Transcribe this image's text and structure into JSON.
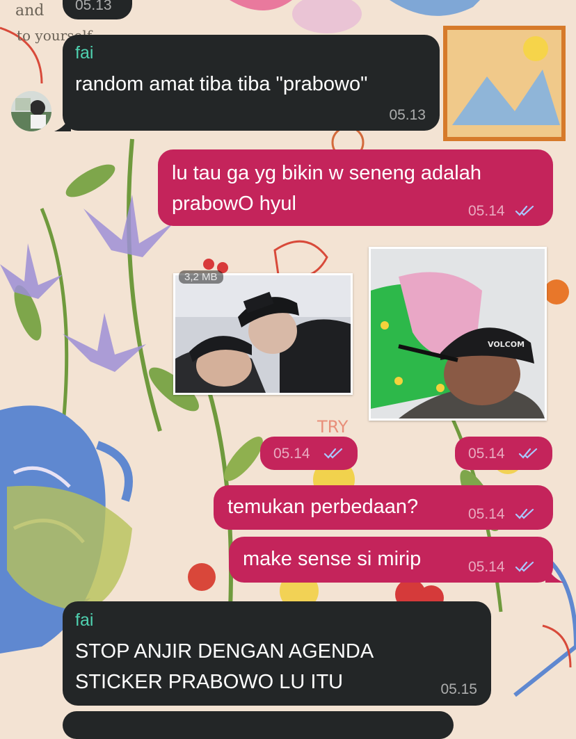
{
  "chat": {
    "top_partial_time": "05.13",
    "messages": [
      {
        "id": "m1",
        "direction": "incoming",
        "sender": "fai",
        "text": "random amat tiba tiba \"prabowo\"",
        "time": "05.13"
      },
      {
        "id": "m2",
        "direction": "outgoing",
        "text": "lu tau ga yg bikin w seneng adalah\nprabowO hyul",
        "time": "05.14",
        "status": "read"
      },
      {
        "id": "m3",
        "direction": "outgoing",
        "type": "image",
        "file_size": "3,2 MB",
        "time": "05.14",
        "status": "read"
      },
      {
        "id": "m4",
        "direction": "outgoing",
        "type": "image",
        "cap_text": "VOLCOM",
        "time": "05.14",
        "status": "read"
      },
      {
        "id": "m5",
        "direction": "outgoing",
        "text": "temukan perbedaan?",
        "time": "05.14",
        "status": "read"
      },
      {
        "id": "m6",
        "direction": "outgoing",
        "text": "make sense si mirip",
        "time": "05.14",
        "status": "read"
      },
      {
        "id": "m7",
        "direction": "incoming",
        "sender": "fai",
        "text": "STOP ANJIR DENGAN AGENDA\nSTICKER PRABOWO LU ITU",
        "time": "05.15"
      }
    ]
  },
  "wallpaper": {
    "doodle_texts": [
      "and",
      "to yourself",
      "TRY"
    ]
  },
  "colors": {
    "incoming_bubble": "#232627",
    "outgoing_bubble": "#c4245b",
    "sender_name": "#4fd1b0",
    "read_ticks": "#a9c8ff",
    "wallpaper_bg": "#f3e3d3"
  },
  "icons": {
    "read_status": "double-check-icon",
    "avatar": "contact-avatar"
  }
}
